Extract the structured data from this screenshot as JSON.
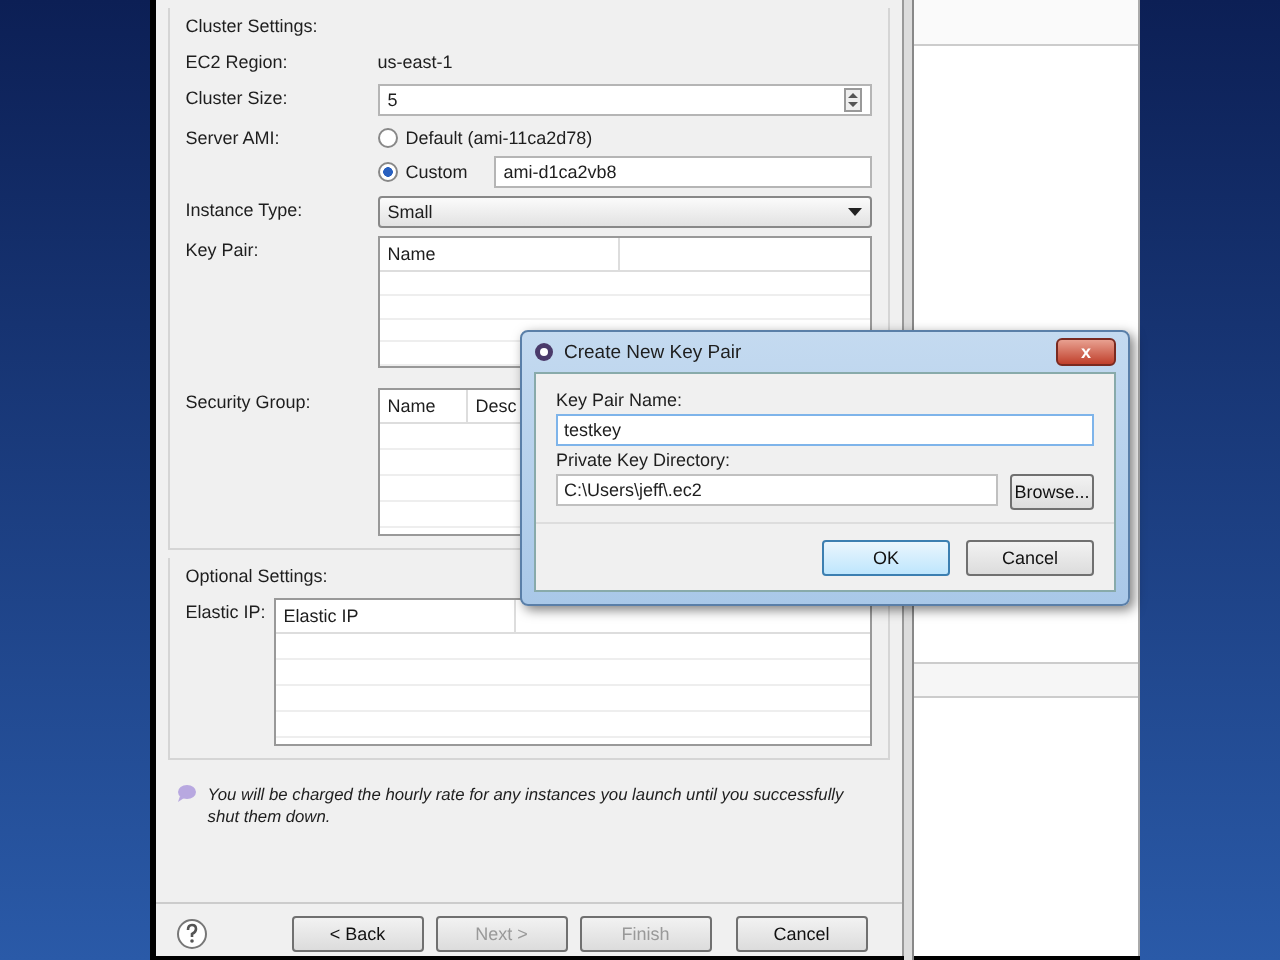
{
  "wizard": {
    "cluster_settings": {
      "title": "Cluster Settings:",
      "ec2_region": {
        "label": "EC2 Region:",
        "value": "us-east-1"
      },
      "cluster_size": {
        "label": "Cluster Size:",
        "value": "5"
      },
      "server_ami": {
        "label": "Server AMI:",
        "options": [
          {
            "label": "Default (ami-11ca2d78)",
            "selected": false
          },
          {
            "label": "Custom",
            "selected": true
          }
        ],
        "custom_value": "ami-d1ca2vb8"
      },
      "instance_type": {
        "label": "Instance Type:",
        "value": "Small"
      },
      "key_pair": {
        "label": "Key Pair:",
        "columns": [
          "Name"
        ]
      },
      "security_group": {
        "label": "Security Group:",
        "columns": [
          "Name",
          "Desc"
        ]
      }
    },
    "optional_settings": {
      "title": "Optional Settings:",
      "elastic_ip": {
        "label": "Elastic IP:",
        "columns": [
          "Elastic IP"
        ]
      }
    },
    "info": "You will be charged the hourly rate for any instances you launch until you successfully shut them down.",
    "buttons": [
      {
        "label": "< Back",
        "disabled": false
      },
      {
        "label": "Next >",
        "disabled": true
      },
      {
        "label": "Finish",
        "disabled": true
      },
      {
        "label": "Cancel",
        "disabled": false
      }
    ]
  },
  "dialog": {
    "title": "Create New Key Pair",
    "close": "x",
    "key_pair_name": {
      "label": "Key Pair Name:",
      "value": "testkey"
    },
    "directory": {
      "label": "Private Key Directory:",
      "value": "C:\\Users\\jeff\\.ec2",
      "browse": "Browse..."
    },
    "buttons": [
      {
        "label": "OK",
        "default": true
      },
      {
        "label": "Cancel",
        "default": false
      }
    ]
  }
}
